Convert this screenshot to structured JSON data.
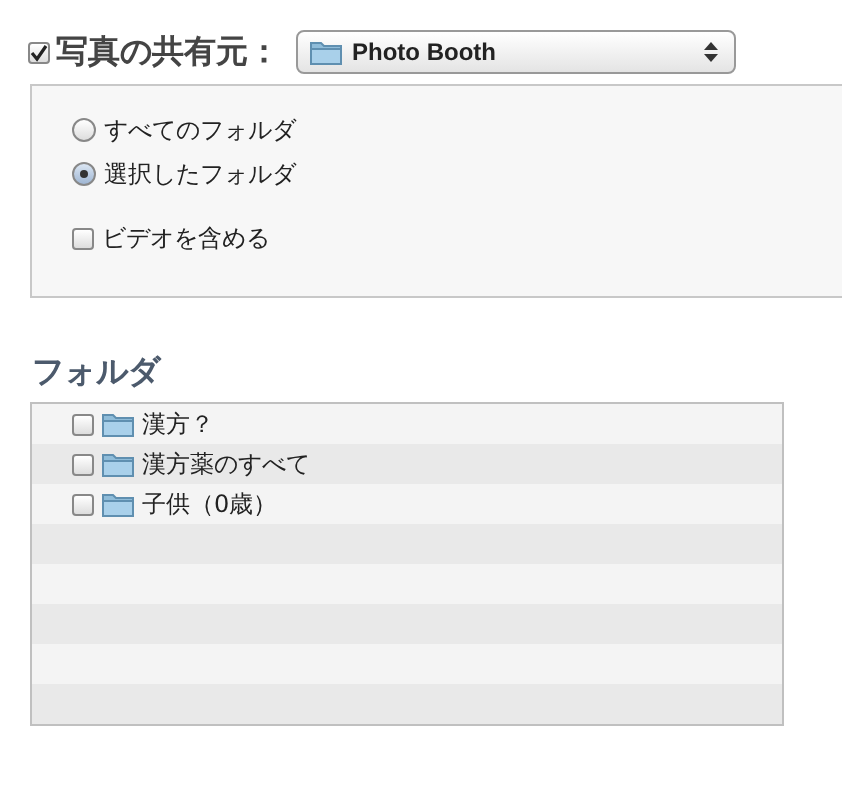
{
  "share": {
    "checked": true,
    "label": "写真の共有元：",
    "source": "Photo Booth"
  },
  "options": [
    {
      "kind": "radio",
      "label": "すべてのフォルダ",
      "selected": false
    },
    {
      "kind": "radio",
      "label": "選択したフォルダ",
      "selected": true
    },
    {
      "kind": "checkbox",
      "label": "ビデオを含める",
      "checked": false
    }
  ],
  "folders": {
    "heading": "フォルダ",
    "items": [
      {
        "name": "漢方？",
        "checked": false
      },
      {
        "name": "漢方薬のすべて",
        "checked": false
      },
      {
        "name": "子供（0歳）",
        "checked": false
      }
    ]
  }
}
